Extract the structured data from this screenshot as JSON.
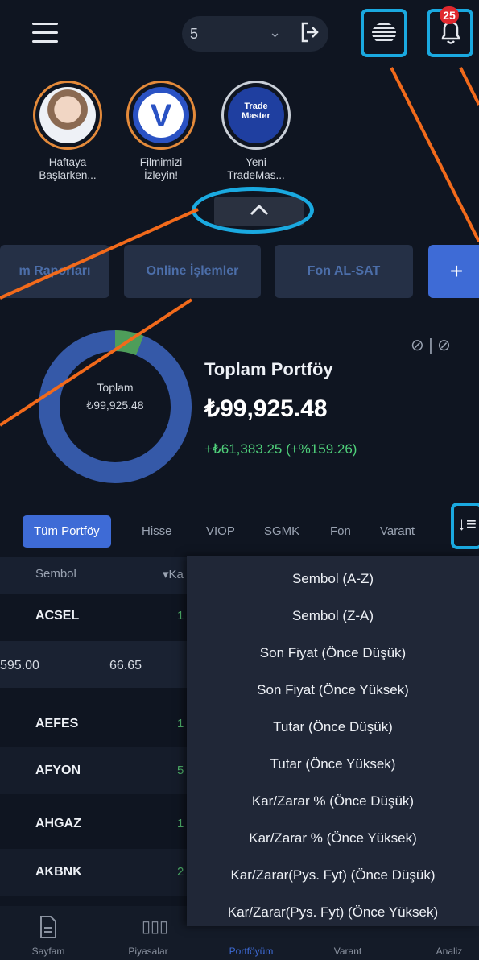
{
  "header": {
    "account_value": "5",
    "notification_count": "25"
  },
  "stories": [
    {
      "caption": "Haftaya\nBaşlarken..."
    },
    {
      "caption": "Filmimizi\nİzleyin!",
      "logo_letter": "V"
    },
    {
      "caption": "Yeni\nTradeMas...",
      "logo_text": "Trade\nMaster"
    }
  ],
  "shortcuts": [
    "m Raporları",
    "Online İşlemler",
    "Fon AL-SAT",
    "+"
  ],
  "portfolio": {
    "donut_label": "Toplam",
    "donut_value": "₺99,925.48",
    "title": "Toplam Portföy",
    "total": "₺99,925.48",
    "pl": "+₺61,383.25 (+%159.26)"
  },
  "tabs": [
    "Tüm Portföy",
    "Hisse",
    "VIOP",
    "SGMK",
    "Fon",
    "Varant"
  ],
  "table": {
    "headers": [
      "Sembol",
      "▾Ka"
    ],
    "rows": [
      {
        "symbol": "ACSEL",
        "value": "1"
      },
      {
        "symbol": "595.00",
        "value": "66.65"
      },
      {
        "symbol": "AEFES",
        "value": "1"
      },
      {
        "symbol": "AFYON",
        "value": "5"
      },
      {
        "symbol": "AHGAZ",
        "value": "1"
      },
      {
        "symbol": "AKBNK",
        "value": "2"
      }
    ]
  },
  "sort_menu": [
    "Sembol (A-Z)",
    "Sembol (Z-A)",
    "Son Fiyat (Önce Düşük)",
    "Son Fiyat (Önce Yüksek)",
    "Tutar (Önce Düşük)",
    "Tutar (Önce Yüksek)",
    "Kar/Zarar % (Önce Düşük)",
    "Kar/Zarar % (Önce Yüksek)",
    "Kar/Zarar(Pys. Fyt) (Önce Düşük)",
    "Kar/Zarar(Pys. Fyt) (Önce Yüksek)"
  ],
  "bottom_nav": [
    "Sayfam",
    "Piyasalar",
    "Portföyüm",
    "Varant",
    "Analiz"
  ],
  "colors": {
    "accent": "#3e6bd6",
    "highlight": "#1aa9e0",
    "annotation": "#f26a1b",
    "gain": "#4fd07a"
  }
}
